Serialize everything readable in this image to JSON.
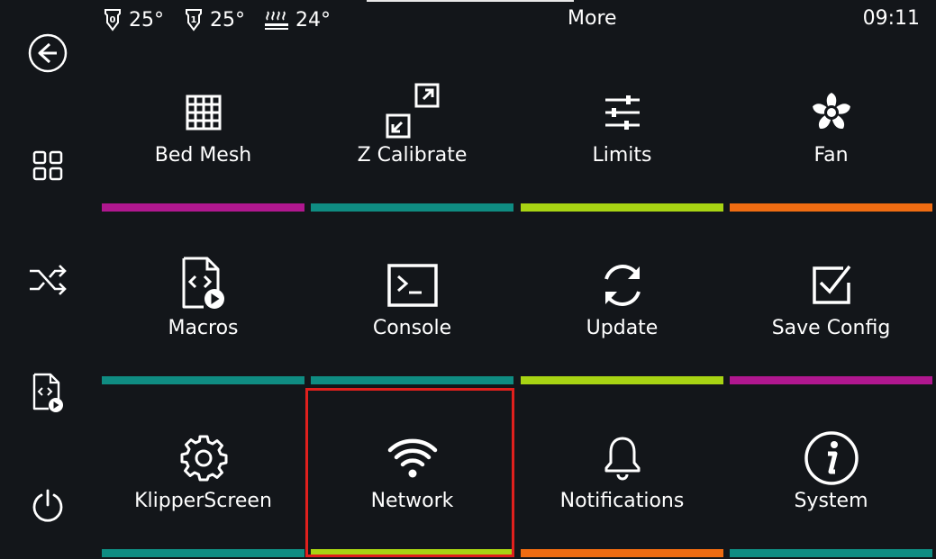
{
  "topbar": {
    "extruder0": {
      "icon": "extruder-0-icon",
      "value": "25°"
    },
    "extruder1": {
      "icon": "extruder-1-icon",
      "value": "25°"
    },
    "bed": {
      "icon": "heated-bed-icon",
      "value": "24°"
    },
    "title": "More",
    "time": "09:11"
  },
  "sidebar": [
    {
      "name": "back-icon"
    },
    {
      "name": "main-menu-icon"
    },
    {
      "name": "shuffle-icon"
    },
    {
      "name": "macros-icon"
    },
    {
      "name": "power-icon"
    }
  ],
  "menu": [
    {
      "label": "Bed Mesh",
      "icon": "grid-icon",
      "color": "#b0178f"
    },
    {
      "label": "Z Calibrate",
      "icon": "z-calibrate-icon",
      "color": "#0f8c82"
    },
    {
      "label": "Limits",
      "icon": "sliders-icon",
      "color": "#a8d413"
    },
    {
      "label": "Fan",
      "icon": "fan-icon",
      "color": "#ef6c12"
    },
    {
      "label": "Macros",
      "icon": "macro-file-icon",
      "color": "#0f8c82"
    },
    {
      "label": "Console",
      "icon": "console-icon",
      "color": "#0f8c82"
    },
    {
      "label": "Update",
      "icon": "refresh-icon",
      "color": "#a8d413"
    },
    {
      "label": "Save Config",
      "icon": "checkbox-icon",
      "color": "#b0178f"
    },
    {
      "label": "KlipperScreen",
      "icon": "gear-icon",
      "color": "#0f8c82"
    },
    {
      "label": "Network",
      "icon": "wifi-icon",
      "color": "#a8d413"
    },
    {
      "label": "Notifications",
      "icon": "bell-icon",
      "color": "#ef6c12"
    },
    {
      "label": "System",
      "icon": "info-icon",
      "color": "#0f8c82"
    }
  ]
}
